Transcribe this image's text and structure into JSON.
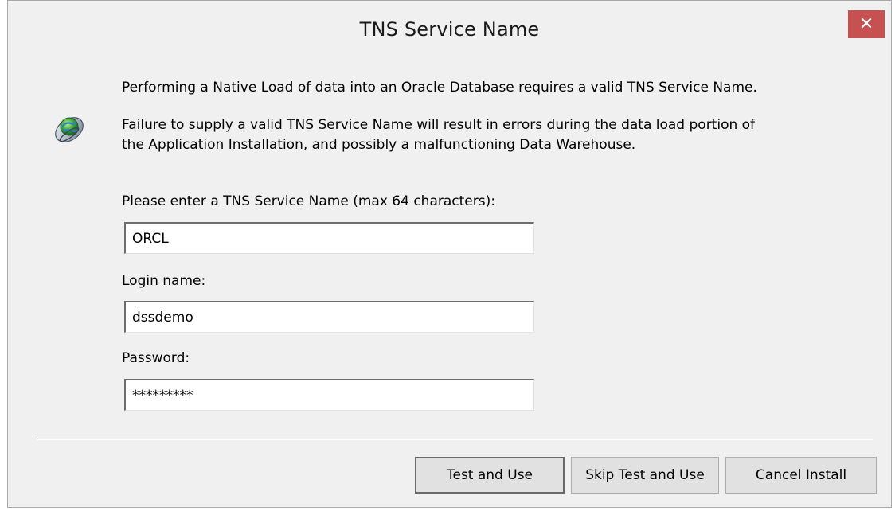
{
  "window": {
    "title": "TNS Service Name",
    "close_glyph": "✕"
  },
  "icon": "oracle-database-icon",
  "message": {
    "line1": "Performing a Native Load of data into an Oracle Database requires a valid TNS Service Name.",
    "line2": "Failure to supply a valid TNS Service Name will result in errors during the data load portion of",
    "line3": "the Application Installation, and possibly a malfunctioning Data Warehouse."
  },
  "fields": {
    "tns": {
      "label": "Please enter a TNS Service Name (max 64 characters):",
      "value": "ORCL"
    },
    "login": {
      "label": "Login name:",
      "value": "dssdemo"
    },
    "password": {
      "label": "Password:",
      "value": "*********"
    }
  },
  "buttons": {
    "test_and_use": "Test and Use",
    "skip_test_and_use": "Skip Test and Use",
    "cancel_install": "Cancel Install"
  },
  "colors": {
    "close_button": "#c75050",
    "dialog_background": "#f0f0f0"
  }
}
